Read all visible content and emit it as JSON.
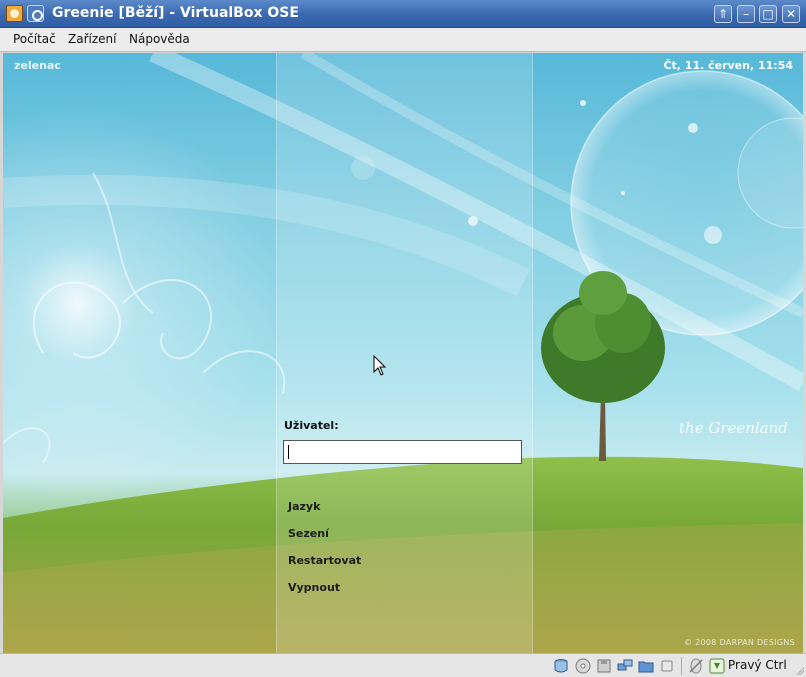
{
  "window": {
    "title": "Greenie [Běží] - VirtualBox OSE",
    "buttons": {
      "roll": "⇑",
      "minimize": "–",
      "maximize": "□",
      "close": "✕"
    }
  },
  "menubar": {
    "items": [
      {
        "label": "Počítač"
      },
      {
        "label": "Zařízení"
      },
      {
        "label": "Nápověda"
      }
    ]
  },
  "vm": {
    "hostname": "zelenac",
    "datetime": "Čt, 11. červen, 11:54",
    "login": {
      "user_label": "Uživatel:",
      "user_value": ""
    },
    "actions": [
      {
        "label": "Jazyk"
      },
      {
        "label": "Sezení"
      },
      {
        "label": "Restartovat"
      },
      {
        "label": "Vypnout"
      }
    ],
    "wallpaper_text": "the Greenland",
    "wallpaper_credit": "© 2008 DARPAN DESIGNS"
  },
  "statusbar": {
    "icons": [
      "hard-disk-icon",
      "cd-dvd-icon",
      "floppy-icon",
      "network-icon",
      "shared-folder-icon",
      "usb-icon",
      "mouse-integration-icon",
      "host-key-icon"
    ],
    "host_key_label": "Pravý Ctrl"
  },
  "colors": {
    "titlebar": "#3a69b0",
    "menubar": "#ececec",
    "statusbar": "#e6e6e6"
  }
}
